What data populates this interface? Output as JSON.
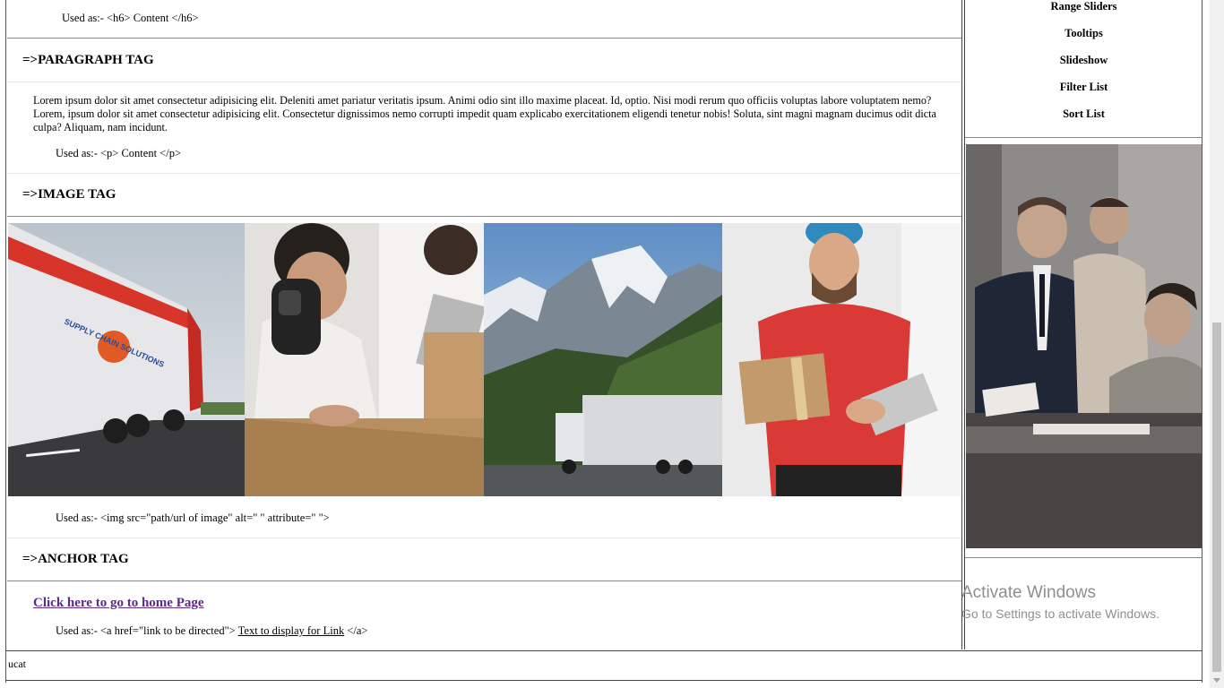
{
  "main": {
    "h6_usage": "Used as:- <h6> Content </h6>",
    "paragraph": {
      "title": "=>PARAGRAPH TAG",
      "text": "Lorem ipsum dolor sit amet consectetur adipisicing elit. Deleniti amet pariatur veritatis ipsum. Animi odio sint illo maxime placeat. Id, optio. Nisi modi rerum quo officiis voluptas labore voluptatem nemo? Lorem, ipsum dolor sit amet consectetur adipisicing elit. Consectetur dignissimos nemo corrupti impedit quam explicabo exercitationem eligendi tenetur nobis! Soluta, sint magni magnam ducimus odit dicta culpa? Aliquam, nam incidunt.",
      "usage": "Used as:- <p> Content </p>"
    },
    "image": {
      "title": "=>IMAGE TAG",
      "usage": "Used as:- <img src=\"path/url of image\" alt=\" \" attribute=\" \">",
      "truck_brand": "SUPPLY CHAIN SOLUTIONS"
    },
    "anchor": {
      "title": "=>ANCHOR TAG",
      "link_text": "Click here to go to home Page",
      "usage_prefix": "Used as:- <a href=\"link to be directed\">",
      "usage_link": "Text to display for Link",
      "usage_suffix": "</a>"
    }
  },
  "sidebar": {
    "items": [
      {
        "label": "Range Sliders"
      },
      {
        "label": "Tooltips"
      },
      {
        "label": "Slideshow"
      },
      {
        "label": "Filter List"
      },
      {
        "label": "Sort List"
      }
    ]
  },
  "watermark": {
    "title": "Activate Windows",
    "subtitle": "Go to Settings to activate Windows."
  },
  "bottom": {
    "text": "ucat"
  },
  "colors": {
    "link": "#5c2a88",
    "truck_red": "#d8352a",
    "shirt_red": "#d93a36"
  }
}
